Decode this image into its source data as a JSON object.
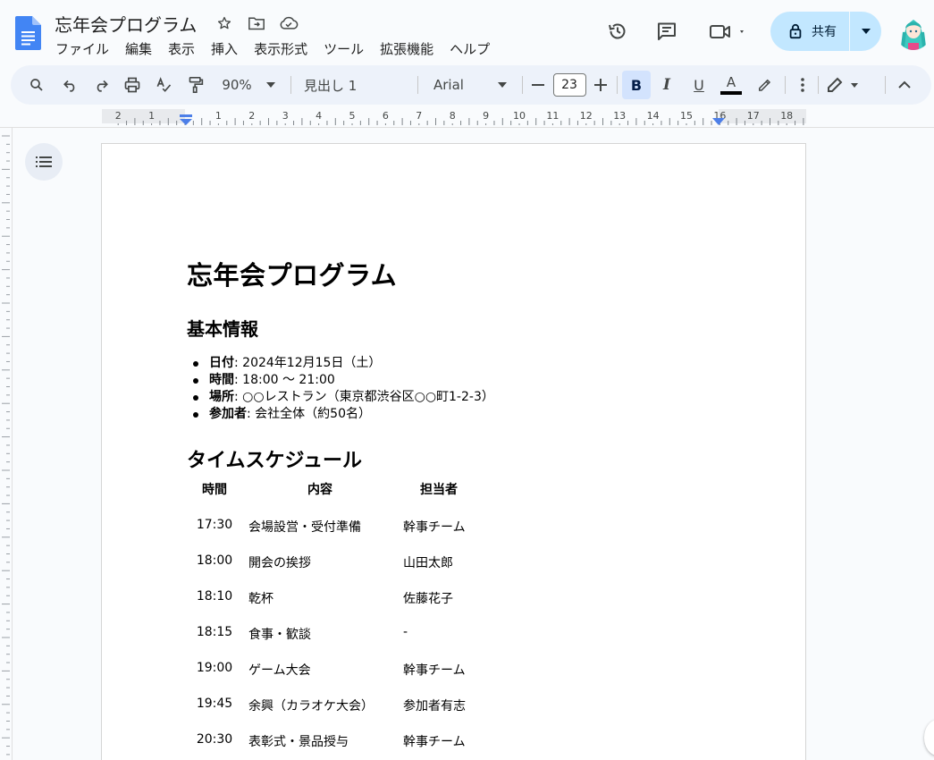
{
  "document_title": "忘年会プログラム",
  "menu": [
    "ファイル",
    "編集",
    "表示",
    "挿入",
    "表示形式",
    "ツール",
    "拡張機能",
    "ヘルプ"
  ],
  "share_label": "共有",
  "toolbar": {
    "zoom": "90%",
    "style": "見出し 1",
    "font": "Arial",
    "font_size": "23",
    "bold": "B",
    "italic": "I",
    "underline": "U",
    "text_color": "A"
  },
  "ruler_labels": [
    "2",
    "1",
    "",
    "1",
    "2",
    "3",
    "4",
    "5",
    "6",
    "7",
    "8",
    "9",
    "10",
    "11",
    "12",
    "13",
    "14",
    "15",
    "16",
    "17",
    "18"
  ],
  "doc": {
    "heading1": "忘年会プログラム",
    "section1_title": "基本情報",
    "info": [
      {
        "label": "日付",
        "value": ": 2024年12月15日（土）"
      },
      {
        "label": "時間",
        "value": ": 18:00 ～ 21:00"
      },
      {
        "label": "場所",
        "value": ": ○○レストラン（東京都渋谷区○○町1-2-3）"
      },
      {
        "label": "参加者",
        "value": ": 会社全体（約50名）"
      }
    ],
    "section2_title": "タイムスケジュール",
    "schedule_headers": [
      "時間",
      "内容",
      "担当者"
    ],
    "schedule": [
      [
        "17:30",
        "会場設営・受付準備",
        "幹事チーム"
      ],
      [
        "18:00",
        "開会の挨拶",
        "山田太郎"
      ],
      [
        "18:10",
        "乾杯",
        "佐藤花子"
      ],
      [
        "18:15",
        "食事・歓談",
        "-"
      ],
      [
        "19:00",
        "ゲーム大会",
        "幹事チーム"
      ],
      [
        "19:45",
        "余興（カラオケ大会）",
        "参加者有志"
      ],
      [
        "20:30",
        "表彰式・景品授与",
        "幹事チーム"
      ]
    ]
  },
  "colors": {
    "accent": "#0b57d0",
    "share_bg": "#c2e7ff",
    "toolbar_bg": "#edf2fa",
    "docs_blue": "#4285f4"
  }
}
